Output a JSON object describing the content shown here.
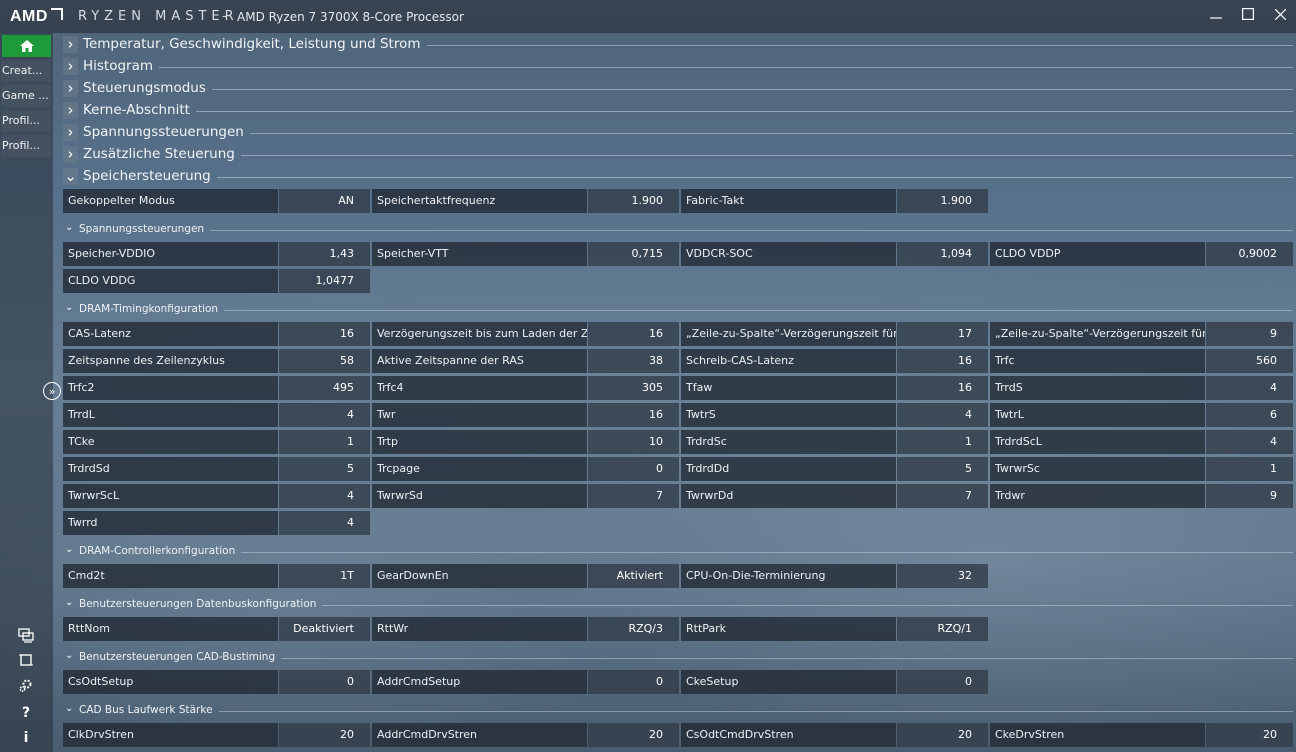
{
  "window": {
    "logo": "AMD",
    "brand": "RYZEN MASTER",
    "separator": "-",
    "processor": "AMD Ryzen 7 3700X 8-Core Processor",
    "min_icon": "minimize-icon",
    "max_icon": "maximize-icon",
    "close_icon": "close-icon"
  },
  "sidebar": {
    "home_icon": "home-icon",
    "items": [
      "Creat...",
      "Game ...",
      "Profil...",
      "Profil..."
    ],
    "bottom_icons": [
      "screen-compare-icon",
      "crop-icon",
      "settings-icon",
      "help-icon",
      "info-icon"
    ]
  },
  "sections": [
    {
      "label": "Temperatur, Geschwindigkeit, Leistung und Strom",
      "chev": ">"
    },
    {
      "label": "Histogram",
      "chev": ">"
    },
    {
      "label": "Steuerungsmodus",
      "chev": ">"
    },
    {
      "label": "Kerne-Abschnitt",
      "chev": ">"
    },
    {
      "label": "Spannungssteuerungen",
      "chev": ">"
    },
    {
      "label": "Zusätzliche Steuerung",
      "chev": ">"
    },
    {
      "label": "Speichersteuerung",
      "chev": "v"
    }
  ],
  "memory": {
    "top_row": [
      {
        "name": "Gekoppelter Modus",
        "value": "AN"
      },
      {
        "name": "Speichertaktfrequenz",
        "value": "1.900"
      },
      {
        "name": "Fabric-Takt",
        "value": "1.900"
      }
    ],
    "subsections": [
      {
        "title": "Spannungssteuerungen",
        "rows": [
          [
            {
              "name": "Speicher-VDDIO",
              "value": "1,43"
            },
            {
              "name": "Speicher-VTT",
              "value": "0,715"
            },
            {
              "name": "VDDCR-SOC",
              "value": "1,094"
            },
            {
              "name": "CLDO VDDP",
              "value": "0,9002"
            }
          ],
          [
            {
              "name": "CLDO VDDG",
              "value": "1,0477"
            }
          ]
        ]
      },
      {
        "title": "DRAM-Timingkonfiguration",
        "rows": [
          [
            {
              "name": "CAS-Latenz",
              "value": "16"
            },
            {
              "name": "Verzögerungszeit bis zum Laden der Zeile",
              "value": "16"
            },
            {
              "name": "„Zeile-zu-Spalte“-Verzögerungszeit für L...",
              "value": "17"
            },
            {
              "name": "„Zeile-zu-Spalte“-Verzögerungszeit für S...",
              "value": "9"
            }
          ],
          [
            {
              "name": "Zeitspanne des Zeilenzyklus",
              "value": "58"
            },
            {
              "name": "Aktive Zeitspanne der RAS",
              "value": "38"
            },
            {
              "name": "Schreib-CAS-Latenz",
              "value": "16"
            },
            {
              "name": "Trfc",
              "value": "560"
            }
          ],
          [
            {
              "name": "Trfc2",
              "value": "495"
            },
            {
              "name": "Trfc4",
              "value": "305"
            },
            {
              "name": "Tfaw",
              "value": "16"
            },
            {
              "name": "TrrdS",
              "value": "4"
            }
          ],
          [
            {
              "name": "TrrdL",
              "value": "4"
            },
            {
              "name": "Twr",
              "value": "16"
            },
            {
              "name": "TwtrS",
              "value": "4"
            },
            {
              "name": "TwtrL",
              "value": "6"
            }
          ],
          [
            {
              "name": "TCke",
              "value": "1"
            },
            {
              "name": "Trtp",
              "value": "10"
            },
            {
              "name": "TrdrdSc",
              "value": "1"
            },
            {
              "name": "TrdrdScL",
              "value": "4"
            }
          ],
          [
            {
              "name": "TrdrdSd",
              "value": "5"
            },
            {
              "name": "Trcpage",
              "value": "0"
            },
            {
              "name": "TrdrdDd",
              "value": "5"
            },
            {
              "name": "TwrwrSc",
              "value": "1"
            }
          ],
          [
            {
              "name": "TwrwrScL",
              "value": "4"
            },
            {
              "name": "TwrwrSd",
              "value": "7"
            },
            {
              "name": "TwrwrDd",
              "value": "7"
            },
            {
              "name": "Trdwr",
              "value": "9"
            }
          ],
          [
            {
              "name": "Twrrd",
              "value": "4"
            }
          ]
        ]
      },
      {
        "title": "DRAM-Controllerkonfiguration",
        "rows": [
          [
            {
              "name": "Cmd2t",
              "value": "1T"
            },
            {
              "name": "GearDownEn",
              "value": "Aktiviert"
            },
            {
              "name": "CPU-On-Die-Terminierung",
              "value": "32"
            }
          ]
        ]
      },
      {
        "title": "Benutzersteuerungen Datenbuskonfiguration",
        "rows": [
          [
            {
              "name": "RttNom",
              "value": "Deaktiviert"
            },
            {
              "name": "RttWr",
              "value": "RZQ/3"
            },
            {
              "name": "RttPark",
              "value": "RZQ/1"
            }
          ]
        ]
      },
      {
        "title": "Benutzersteuerungen CAD-Bustiming",
        "rows": [
          [
            {
              "name": "CsOdtSetup",
              "value": "0"
            },
            {
              "name": "AddrCmdSetup",
              "value": "0"
            },
            {
              "name": "CkeSetup",
              "value": "0"
            }
          ]
        ]
      },
      {
        "title": "CAD Bus Laufwerk Stärke",
        "rows": [
          [
            {
              "name": "ClkDrvStren",
              "value": "20"
            },
            {
              "name": "AddrCmdDrvStren",
              "value": "20"
            },
            {
              "name": "CsOdtCmdDrvStren",
              "value": "20"
            },
            {
              "name": "CkeDrvStren",
              "value": "20"
            }
          ]
        ]
      }
    ]
  }
}
